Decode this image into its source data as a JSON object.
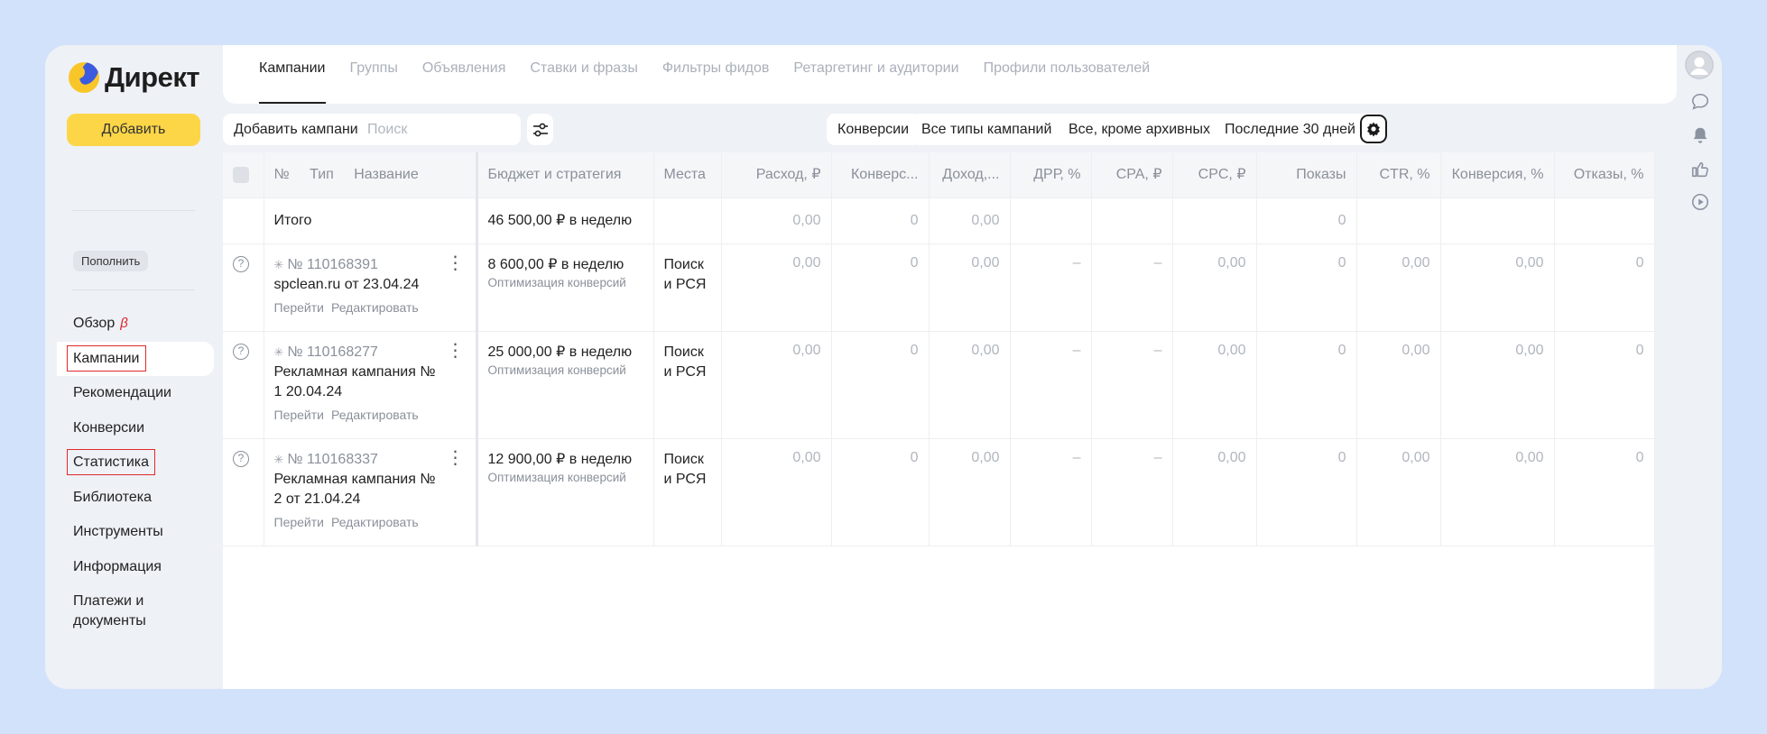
{
  "brand": {
    "name": "Директ",
    "colors": {
      "yellow": "#fcd647",
      "blue": "#3b5be0",
      "frame": "#d2e2fb"
    }
  },
  "sidebar": {
    "add_label": "Добавить",
    "topup_label": "Пополнить",
    "items": [
      {
        "label": "Обзор",
        "badge": "β"
      },
      {
        "label": "Кампании"
      },
      {
        "label": "Рекомендации"
      },
      {
        "label": "Конверсии"
      },
      {
        "label": "Статистика"
      },
      {
        "label": "Библиотека"
      },
      {
        "label": "Инструменты"
      },
      {
        "label": "Информация"
      },
      {
        "label": "Платежи и документы"
      }
    ]
  },
  "header": {
    "tabs": [
      {
        "label": "Кампании"
      },
      {
        "label": "Группы"
      },
      {
        "label": "Объявления"
      },
      {
        "label": "Ставки и фразы"
      },
      {
        "label": "Фильтры фидов"
      },
      {
        "label": "Ретаргетинг и аудитории"
      },
      {
        "label": "Профили пользователей"
      }
    ]
  },
  "toolbar": {
    "add_campaign_label": "Добавить кампанию",
    "search_placeholder": "Поиск",
    "conversions_label": "Конверсии",
    "type_filter_label": "Все типы кампаний",
    "status_filter_label": "Все, кроме архивных",
    "period_label": "Последние 30 дней"
  },
  "table": {
    "columns": {
      "num": "№",
      "type": "Тип",
      "name": "Название",
      "budget": "Бюджет и стратегия",
      "places": "Места",
      "spend": "Расход, ₽",
      "conversions": "Конверс...",
      "revenue": "Доход,...",
      "drr": "ДРР, %",
      "cpa": "CPA, ₽",
      "cpc": "CPC, ₽",
      "impressions": "Показы",
      "ctr": "CTR, %",
      "conv_rate": "Конверсия, %",
      "bounces": "Отказы, %"
    },
    "total": {
      "label": "Итого",
      "budget": "46 500,00 ₽ в неделю",
      "spend": "0,00",
      "conversions": "0",
      "revenue": "0,00",
      "impressions": "0"
    },
    "links": {
      "go": "Перейти",
      "edit": "Редактировать"
    },
    "rows": [
      {
        "num": "№ 110168391",
        "name": "spclean.ru от 23.04.24",
        "budget": "8 600,00 ₽ в неделю",
        "strategy": "Оптимизация конверсий",
        "places": "Поиск и РСЯ",
        "spend": "0,00",
        "conversions": "0",
        "revenue": "0,00",
        "drr": "–",
        "cpa": "–",
        "cpc": "0,00",
        "impressions": "0",
        "ctr": "0,00",
        "conv_rate": "0,00",
        "bounces": "0"
      },
      {
        "num": "№ 110168277",
        "name": "Рекламная кампания № 1 20.04.24",
        "budget": "25 000,00 ₽ в неделю",
        "strategy": "Оптимизация конверсий",
        "places": "Поиск и РСЯ",
        "spend": "0,00",
        "conversions": "0",
        "revenue": "0,00",
        "drr": "–",
        "cpa": "–",
        "cpc": "0,00",
        "impressions": "0",
        "ctr": "0,00",
        "conv_rate": "0,00",
        "bounces": "0"
      },
      {
        "num": "№ 110168337",
        "name": "Рекламная кампания № 2 от 21.04.24",
        "budget": "12 900,00 ₽ в неделю",
        "strategy": "Оптимизация конверсий",
        "places": "Поиск и РСЯ",
        "spend": "0,00",
        "conversions": "0",
        "revenue": "0,00",
        "drr": "–",
        "cpa": "–",
        "cpc": "0,00",
        "impressions": "0",
        "ctr": "0,00",
        "conv_rate": "0,00",
        "bounces": "0"
      }
    ]
  },
  "rail": {
    "icons": [
      "avatar",
      "chat-icon",
      "bell-icon",
      "thumbs-up-icon",
      "play-icon"
    ]
  }
}
